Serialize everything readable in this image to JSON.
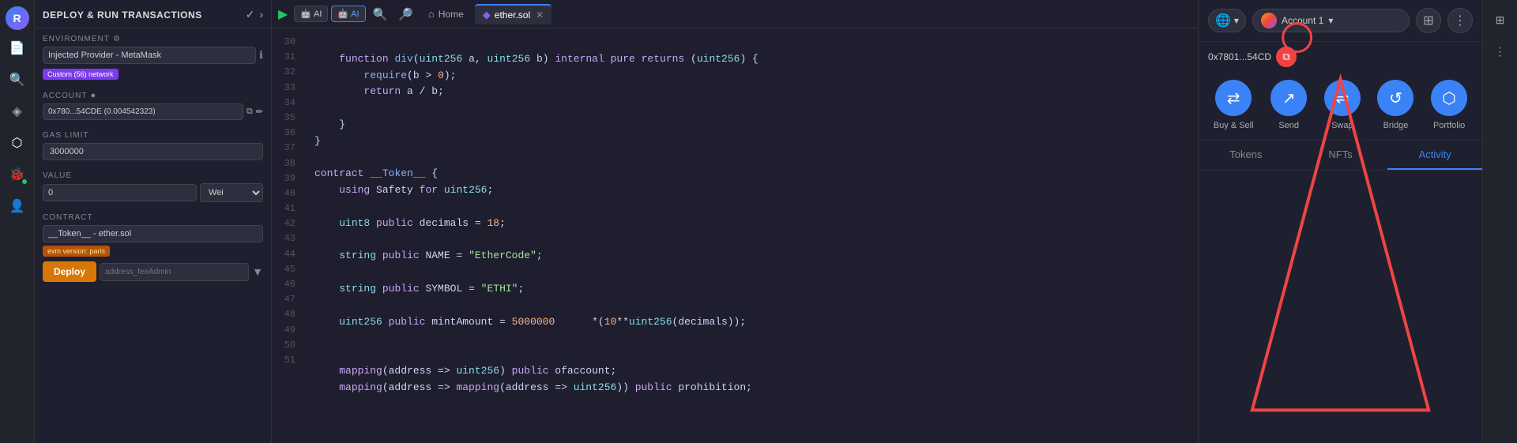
{
  "app": {
    "title": "DEPLOY & RUN TRANSACTIONS"
  },
  "deploy_panel": {
    "title": "DEPLOY & RUN TRANSACTIONS",
    "environment_label": "ENVIRONMENT",
    "environment_value": "Injected Provider - MetaMask",
    "custom_network_badge": "Custom (56) network",
    "account_label": "ACCOUNT",
    "account_value": "0x780...54CDE (0.004542323)",
    "gas_limit_label": "GAS LIMIT",
    "gas_limit_value": "3000000",
    "value_label": "VALUE",
    "value_input": "0",
    "value_unit": "Wei",
    "contract_label": "CONTRACT",
    "contract_value": "__Token__ - ether.sol",
    "evm_badge": "evm version: paris",
    "deploy_btn": "Deploy",
    "deploy_placeholder": "address_feeAdmin"
  },
  "editor": {
    "run_icon": "▶",
    "ai_label1": "AI",
    "ai_label2": "AI",
    "tab_home": "Home",
    "tab_file": "ether.sol",
    "lines": [
      30,
      31,
      32,
      33,
      34,
      35,
      36,
      37,
      38,
      39,
      40,
      41,
      42,
      43,
      44,
      45,
      46,
      47,
      48,
      49,
      50,
      51
    ],
    "code_lines": [
      "",
      "    function div(uint256 a, uint256 b) internal pure returns (uint256) {",
      "        require(b > 0);",
      "        return a / b;",
      "",
      "    }",
      "}",
      "",
      "contract __Token__ {",
      "    using Safety for uint256;",
      "",
      "    uint8 public decimals = 18;",
      "",
      "    string public NAME = \"EtherCode\";",
      "",
      "    string public SYMBOL = \"ETHI\";",
      "",
      "    uint256 public mintAmount = 5000000      *(10**uint256(decimals));",
      "",
      "",
      "    mapping(address => uint256) public ofaccount;",
      "    mapping(address => mapping(address => uint256)) public prohibition;"
    ]
  },
  "metamask": {
    "network_name": "🌐",
    "account_name": "Account 1",
    "address": "0x7801...54CD",
    "buy_sell_label": "Buy & Sell",
    "send_label": "Send",
    "swap_label": "Swap",
    "bridge_label": "Bridge",
    "portfolio_label": "Portfolio",
    "tab_tokens": "Tokens",
    "tab_nfts": "NFTs",
    "tab_activity": "Activity"
  },
  "icons": {
    "copy": "⧉",
    "chevron_down": "▾",
    "menu": "⋮",
    "grid": "⊞",
    "close": "✕",
    "home": "⌂",
    "search": "🔍",
    "zoom_in": "🔎"
  }
}
